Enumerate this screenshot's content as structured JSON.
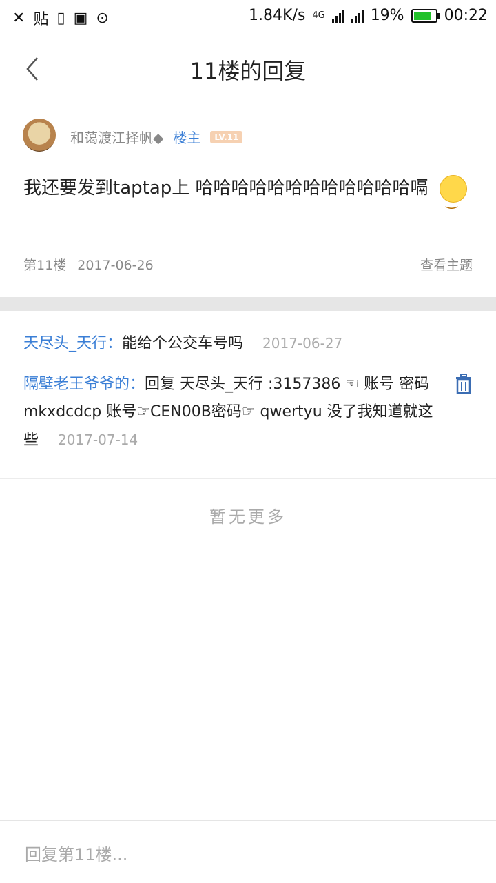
{
  "status_bar": {
    "left_glyphs": [
      "✕",
      "贴",
      "▯",
      "▣",
      "⊙"
    ],
    "speed": "1.84K/s",
    "network": "4G",
    "battery": "19%",
    "time": "00:22"
  },
  "header": {
    "title": "11楼的回复"
  },
  "post": {
    "username": "和蔼渡江择帆◆",
    "owner_label": "楼主",
    "level": "LV.11",
    "content": "我还要发到taptap上 哈哈哈哈哈哈哈哈哈哈哈哈嗝",
    "floor_label": "第11楼",
    "date": "2017-06-26",
    "view_topic_label": "查看主题"
  },
  "replies": [
    {
      "name": "天尽头_天行：",
      "text": "能给个公交车号吗",
      "date": "2017-06-27"
    },
    {
      "name": "隔壁老王爷爷的：",
      "text": "回复 天尽头_天行 :3157386 ☜ 账号 密码mkxdcdcp 账号☞CEN00B密码☞ qwertyu 没了我知道就这些",
      "date": "2017-07-14"
    }
  ],
  "no_more": "暂无更多",
  "reply_input": {
    "placeholder": "回复第11楼..."
  },
  "colors": {
    "link": "#3b7fd6",
    "muted": "#888888",
    "divider": "#e6e6e6",
    "battery": "#22c12a"
  }
}
